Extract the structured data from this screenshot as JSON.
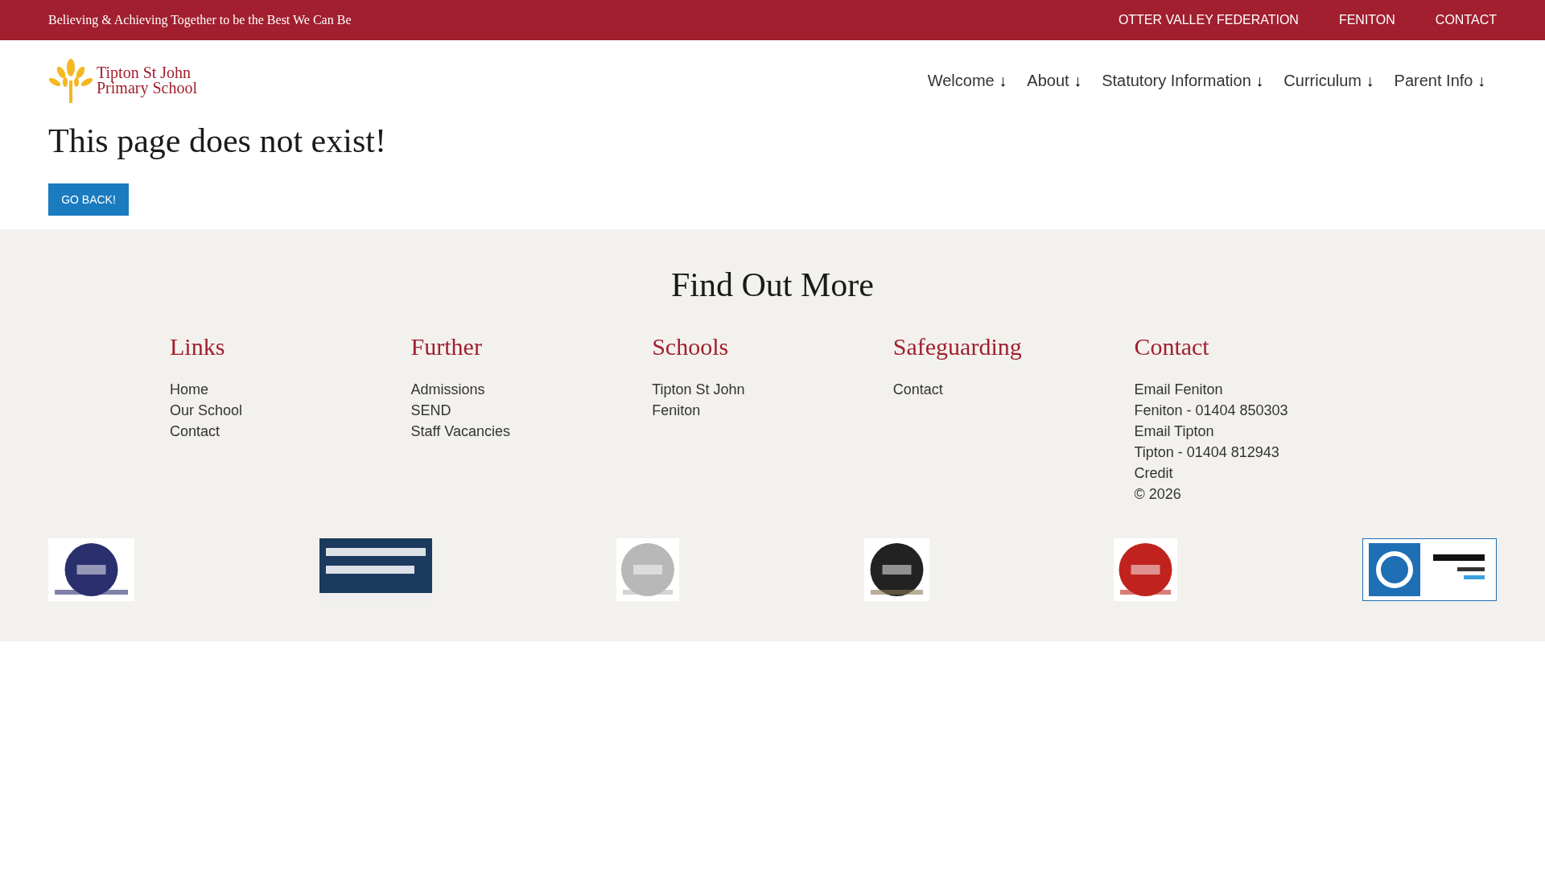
{
  "top_bar": {
    "tagline": "Believing & Achieving Together to be the Best We Can Be",
    "links": [
      "OTTER VALLEY FEDERATION",
      "FENITON",
      "CONTACT"
    ]
  },
  "header": {
    "logo_lines": [
      "Tipton St John",
      "Primary School"
    ],
    "nav": [
      {
        "label": "Welcome",
        "arrow": "↓"
      },
      {
        "label": "About",
        "arrow": "↓"
      },
      {
        "label": "Statutory Information",
        "arrow": "↓"
      },
      {
        "label": "Curriculum",
        "arrow": "↓"
      },
      {
        "label": "Parent Info",
        "arrow": "↓"
      }
    ]
  },
  "main": {
    "heading": "This page does not exist!",
    "button": "GO BACK!"
  },
  "footer": {
    "title": "Find Out More",
    "columns": [
      {
        "heading": "Links",
        "items": [
          "Home",
          "Our School",
          "Contact"
        ]
      },
      {
        "heading": "Further",
        "items": [
          "Admissions",
          "SEND",
          "Staff Vacancies"
        ]
      },
      {
        "heading": "Schools",
        "items": [
          "Tipton St John",
          "Feniton"
        ]
      },
      {
        "heading": "Safeguarding",
        "items": [
          "Contact"
        ]
      },
      {
        "heading": "Contact",
        "items": [
          "Email Feniton",
          "Feniton - 01404 850303",
          "Email Tipton",
          "Tipton - 01404 812943",
          "Credit",
          "© 2026"
        ]
      }
    ]
  }
}
